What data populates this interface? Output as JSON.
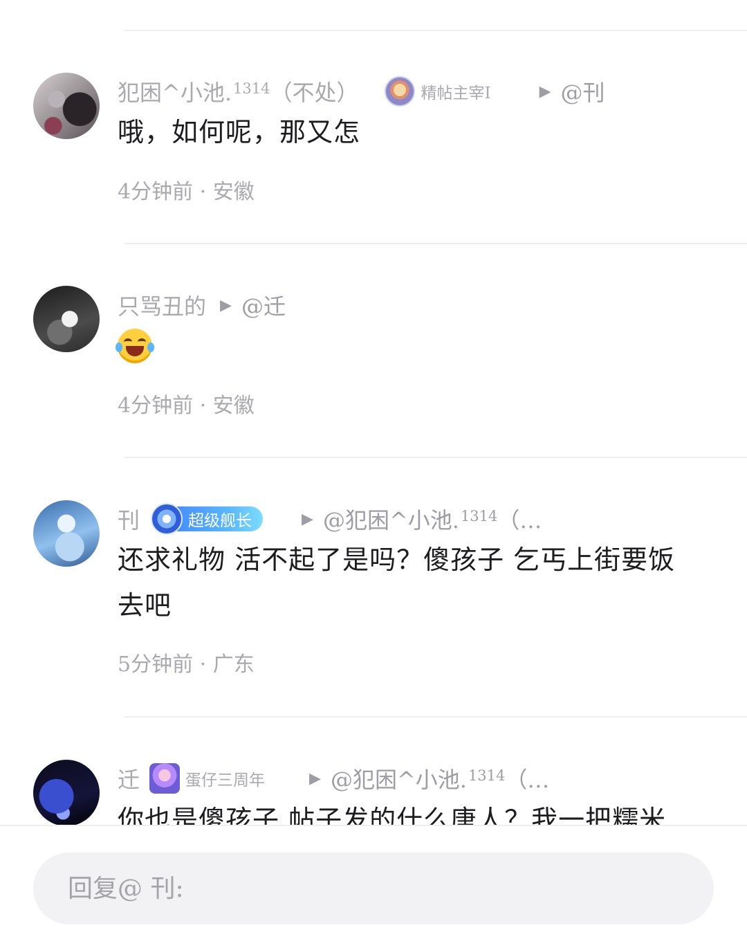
{
  "comments": [
    {
      "username": "犯困^小池.",
      "username_sup": "1314",
      "username_suffix": "（不处）",
      "badge_type": "medal",
      "badge_label": "精帖主宰Ⅰ",
      "reply_to": "@刊",
      "text": "哦，如何呢，那又怎",
      "time": "4分钟前",
      "location": "安徽"
    },
    {
      "username": "只骂丑的",
      "reply_to": "@迁",
      "emoji": "laughing-crying-emoji",
      "time": "4分钟前",
      "location": "安徽"
    },
    {
      "username": "刊",
      "badge_type": "vip",
      "badge_label": "超级舰长",
      "reply_to": "@犯困^小池.",
      "reply_to_sup": "1314",
      "reply_to_suffix": "（…",
      "text": "还求礼物 活不起了是吗？傻孩子  乞丐上街要饭去吧",
      "time": "5分钟前",
      "location": "广东"
    },
    {
      "username": "迁",
      "badge_type": "anniversary",
      "badge_label": "蛋仔三周年",
      "reply_to": "@犯困^小池.",
      "reply_to_sup": "1314",
      "reply_to_suffix": "（…",
      "text": "你也是傻孩子 帖子发的什么唐人？我一把糯米"
    }
  ],
  "separator": "·",
  "reply_bar": {
    "placeholder": "回复@ 刊:"
  },
  "colors": {
    "muted_text": "#a9a9ae",
    "body_text": "#1d1d1f",
    "vip_gradient_start": "#3d7bff",
    "input_bg": "#f2f2f4"
  }
}
